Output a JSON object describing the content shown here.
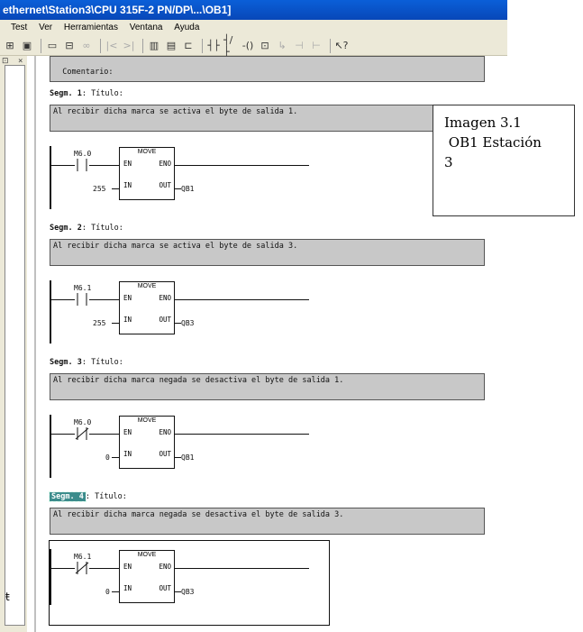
{
  "window": {
    "title": "ethernet\\Station3\\CPU 315F-2 PN/DP\\...\\OB1]"
  },
  "menu": [
    "Test",
    "Ver",
    "Herramientas",
    "Ventana",
    "Ayuda"
  ],
  "top_comment": "Comentario:",
  "segments": [
    {
      "label": "Segm.",
      "number": "1",
      "title": ": Título:",
      "comment": "Al recibir dicha marca se activa el byte de salida 1.",
      "contact": "M6.0",
      "contact_type": "normally-open",
      "block": "MOVE",
      "pins": {
        "en": "EN",
        "eno": "ENO",
        "in": "IN",
        "out": "OUT"
      },
      "in_value": "255",
      "out_value": "QB1"
    },
    {
      "label": "Segm.",
      "number": "2",
      "title": ": Título:",
      "comment": "Al recibir dicha marca se activa el byte de salida 3.",
      "contact": "M6.1",
      "contact_type": "normally-open",
      "block": "MOVE",
      "pins": {
        "en": "EN",
        "eno": "ENO",
        "in": "IN",
        "out": "OUT"
      },
      "in_value": "255",
      "out_value": "QB3"
    },
    {
      "label": "Segm.",
      "number": "3",
      "title": ": Título:",
      "comment": "Al recibir dicha marca negada se desactiva el byte de salida 1.",
      "contact": "M6.0",
      "contact_type": "normally-closed",
      "block": "MOVE",
      "pins": {
        "en": "EN",
        "eno": "ENO",
        "in": "IN",
        "out": "OUT"
      },
      "in_value": "0",
      "out_value": "QB1"
    },
    {
      "label": "Segm.",
      "number": "4",
      "title": ": Título:",
      "comment": "Al recibir dicha marca negada se desactiva el byte de salida 3.",
      "contact": "M6.1",
      "contact_type": "normally-closed",
      "block": "MOVE",
      "pins": {
        "en": "EN",
        "eno": "ENO",
        "in": "IN",
        "out": "OUT"
      },
      "in_value": "0",
      "out_value": "QB3"
    }
  ],
  "note": {
    "line1": "Imagen 3.1",
    "line2": " OB1 Estación",
    "line3": "3"
  },
  "icons": [
    "new-icon",
    "open-icon",
    "save-icon",
    "print-icon",
    "cut-icon",
    "copy-icon",
    "paste-icon",
    "undo-icon",
    "redo-icon",
    "view-icon",
    "monitor-icon",
    "network-icon",
    "no-contact-icon",
    "nc-contact-icon",
    "coil-icon",
    "box-icon",
    "branch-open-icon",
    "branch-close-icon",
    "connection-icon",
    "help-icon"
  ]
}
